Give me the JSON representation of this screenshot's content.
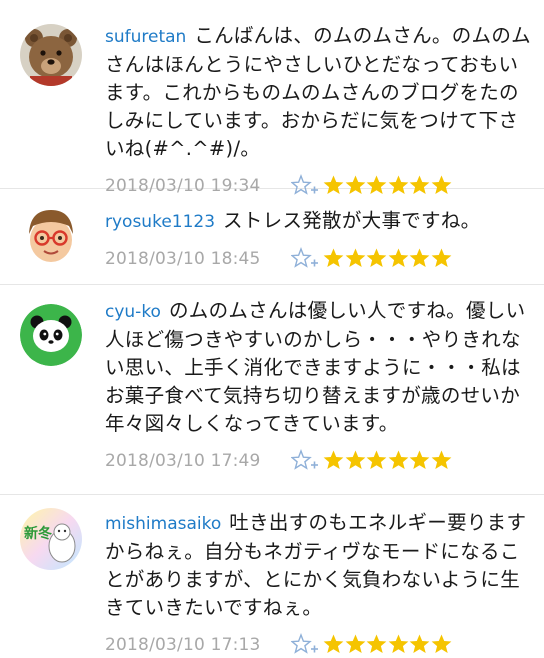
{
  "comments": [
    {
      "username": "sufuretan",
      "text": "こんばんは、のムのムさん。のムのムさんはほんとうにやさしいひとだなっておもいます。これからものムのムさんのブログをたのしみにしています。おからだに気をつけて下さいね(#^.^#)/。",
      "timestamp": "2018/03/10 19:34",
      "star_count": 6,
      "avatar_icon": "teddy-bear-icon"
    },
    {
      "username": "ryosuke1123",
      "text": "ストレス発散が大事ですね。",
      "timestamp": "2018/03/10 18:45",
      "star_count": 6,
      "avatar_icon": "boy-with-glasses-icon"
    },
    {
      "username": "cyu-ko",
      "text": "のムのムさんは優しい人ですね。優しい人ほど傷つきやすいのかしら・・・やりきれない思い、上手く消化できますように・・・私はお菓子食べて気持ち切り替えますが歳のせいか年々図々しくなってきています。",
      "timestamp": "2018/03/10 17:49",
      "star_count": 6,
      "avatar_icon": "panda-icon"
    },
    {
      "username": "mishimasaiko",
      "text": "吐き出すのもエネルギー要りますからねぇ。自分もネガティヴなモードになることがありますが、とにかく気負わないように生きていきたいですねぇ。",
      "timestamp": "2018/03/10 17:13",
      "star_count": 6,
      "avatar_icon": "shinto-new-winter-icon",
      "avatar_text": "新冬"
    }
  ],
  "colors": {
    "username": "#1f7bc7",
    "star": "#f5c400",
    "star_add": "#8fb0d8",
    "timestamp": "#a8a8a8"
  },
  "icons": {
    "star_add": "add-star-icon",
    "star": "star-icon"
  }
}
